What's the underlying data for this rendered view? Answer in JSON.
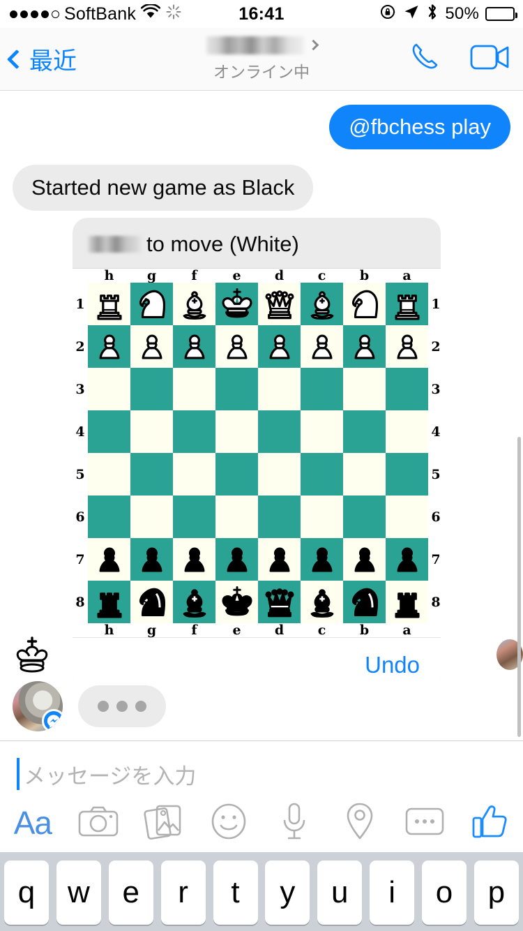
{
  "status_bar": {
    "carrier": "SoftBank",
    "signal_dots_filled": 4,
    "signal_dots_total": 5,
    "wifi_icon": "wifi-icon",
    "spinner_icon": "activity-spinner-icon",
    "time": "16:41",
    "rotation_lock_icon": "rotation-lock-icon",
    "location_icon": "location-arrow-icon",
    "bluetooth_icon": "bluetooth-icon",
    "battery_percent": "50%",
    "battery_level": 50
  },
  "nav": {
    "back_label": "最近",
    "back_icon": "chevron-left-icon",
    "contact_name_redacted": true,
    "contact_chevron_icon": "chevron-right-icon",
    "presence": "オンライン中",
    "call_icon": "phone-icon",
    "video_icon": "video-camera-icon"
  },
  "thread": {
    "messages": [
      {
        "id": "m1",
        "side": "outgoing",
        "text": "@fbchess play"
      },
      {
        "id": "m2",
        "side": "incoming",
        "text": "Started new game as Black"
      }
    ],
    "chess_card": {
      "header_prefix_redacted": true,
      "header_text": "to move (White)",
      "undo_label": "Undo"
    },
    "typing_indicator": {
      "visible": true,
      "dots": 3
    },
    "king_icon": "white-king-icon",
    "avatar_badge_icon": "messenger-badge-icon"
  },
  "chess_board": {
    "orientation": "black",
    "files": [
      "h",
      "g",
      "f",
      "e",
      "d",
      "c",
      "b",
      "a"
    ],
    "ranks": [
      "1",
      "2",
      "3",
      "4",
      "5",
      "6",
      "7",
      "8"
    ],
    "light_square_color": "#fffff0",
    "dark_square_color": "#2ba394",
    "rows": [
      {
        "rank": "1",
        "pieces": [
          "wR",
          "wN",
          "wB",
          "wK",
          "wQ",
          "wB",
          "wN",
          "wR"
        ]
      },
      {
        "rank": "2",
        "pieces": [
          "wP",
          "wP",
          "wP",
          "wP",
          "wP",
          "wP",
          "wP",
          "wP"
        ]
      },
      {
        "rank": "3",
        "pieces": [
          "",
          "",
          "",
          "",
          "",
          "",
          "",
          ""
        ]
      },
      {
        "rank": "4",
        "pieces": [
          "",
          "",
          "",
          "",
          "",
          "",
          "",
          ""
        ]
      },
      {
        "rank": "5",
        "pieces": [
          "",
          "",
          "",
          "",
          "",
          "",
          "",
          ""
        ]
      },
      {
        "rank": "6",
        "pieces": [
          "",
          "",
          "",
          "",
          "",
          "",
          "",
          ""
        ]
      },
      {
        "rank": "7",
        "pieces": [
          "bP",
          "bP",
          "bP",
          "bP",
          "bP",
          "bP",
          "bP",
          "bP"
        ]
      },
      {
        "rank": "8",
        "pieces": [
          "bR",
          "bN",
          "bB",
          "bK",
          "bQ",
          "bB",
          "bN",
          "bR"
        ]
      }
    ]
  },
  "composer": {
    "placeholder": "メッセージを入力",
    "value": "",
    "tools": [
      {
        "name": "text-format-button",
        "label": "Aa"
      },
      {
        "name": "camera-button",
        "label": ""
      },
      {
        "name": "photo-library-button",
        "label": ""
      },
      {
        "name": "sticker-button",
        "label": ""
      },
      {
        "name": "voice-record-button",
        "label": ""
      },
      {
        "name": "location-button",
        "label": ""
      },
      {
        "name": "more-options-button",
        "label": ""
      },
      {
        "name": "thumbs-up-button",
        "label": ""
      }
    ]
  },
  "keyboard": {
    "row1": [
      "q",
      "w",
      "e",
      "r",
      "t",
      "y",
      "u",
      "i",
      "o",
      "p"
    ]
  },
  "colors": {
    "accent_blue": "#1084fb",
    "nav_blue": "#0b84ff",
    "bubble_in": "#ebebeb",
    "board_dark": "#2ba394",
    "board_light": "#fffff0",
    "keyboard_bg": "#ccd0d7"
  }
}
